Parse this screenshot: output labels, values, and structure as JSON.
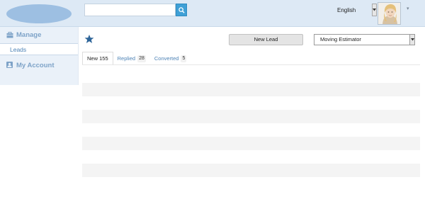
{
  "header": {
    "search": {
      "value": "",
      "placeholder": ""
    },
    "language": "English"
  },
  "sidebar": {
    "manage_label": "Manage",
    "leads_label": "Leads",
    "account_label": "My Account"
  },
  "toolbar": {
    "new_lead_label": "New Lead",
    "estimator_selected": "Moving Estimator"
  },
  "tabs": [
    {
      "label": "New",
      "count": "155"
    },
    {
      "label": "Replied",
      "count": "28"
    },
    {
      "label": "Converted",
      "count": "5"
    }
  ],
  "colors": {
    "header_bg": "#dde9f5",
    "accent": "#3fa0d6",
    "link": "#4e83b6",
    "star": "#2e6599"
  },
  "icons": [
    "search-icon",
    "language-caret-icon",
    "avatar-photo",
    "user-menu-caret-icon",
    "manage-icon",
    "account-icon",
    "favorite-star-icon",
    "select-caret-icon"
  ]
}
